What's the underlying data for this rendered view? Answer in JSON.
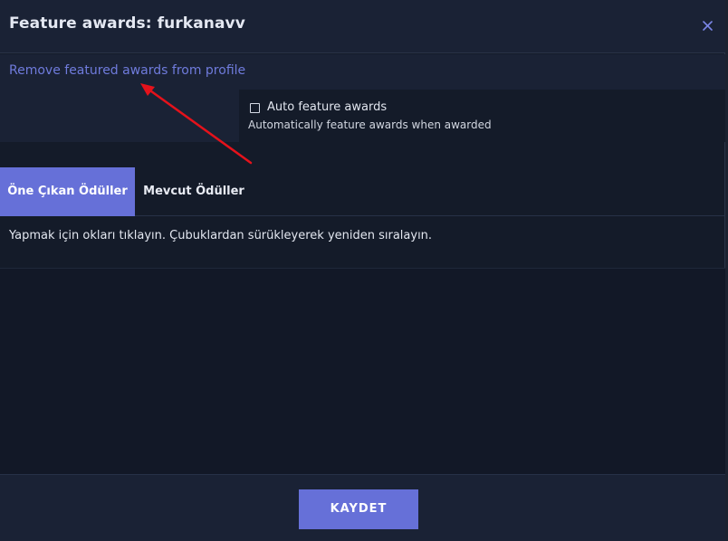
{
  "modal": {
    "title": "Feature awards: furkanavv",
    "close_icon": "close-icon"
  },
  "remove_link": "Remove featured awards from profile",
  "auto_feature": {
    "label": "Auto feature awards",
    "description": "Automatically feature awards when awarded",
    "checked": false
  },
  "tabs": [
    {
      "label": "Öne Çıkan Ödüller",
      "active": true
    },
    {
      "label": "Mevcut Ödüller",
      "active": false
    }
  ],
  "instructions": "Yapmak için okları tıklayın. Çubuklardan sürükleyerek yeniden sıralayın.",
  "footer": {
    "save_label": "KAYDET"
  },
  "colors": {
    "accent": "#6670d8",
    "link": "#6f7bdc",
    "annotation_arrow": "#e5121b"
  }
}
